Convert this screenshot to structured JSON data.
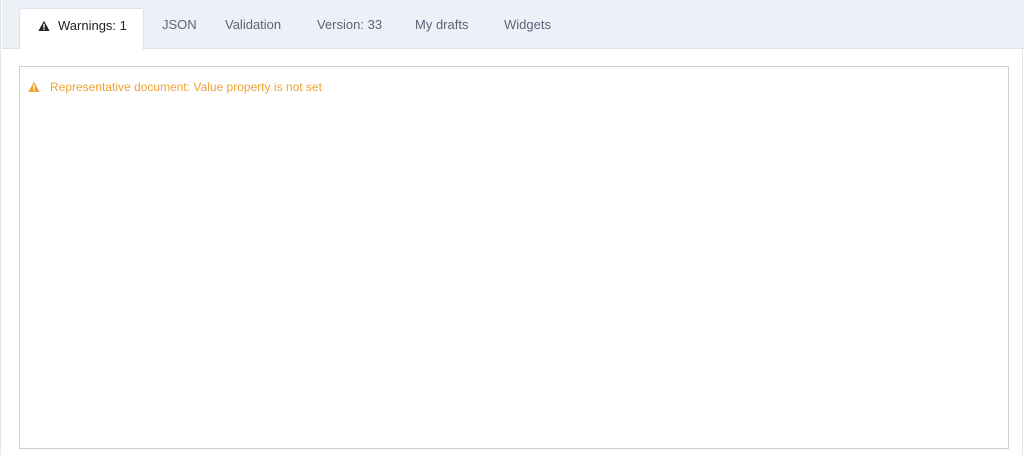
{
  "tabs": [
    {
      "label": "Warnings: 1",
      "icon": "warning-icon",
      "active": true
    },
    {
      "label": "JSON"
    },
    {
      "label": "Validation"
    },
    {
      "label": "Version: 33"
    },
    {
      "label": "My drafts"
    },
    {
      "label": "Widgets"
    }
  ],
  "panel": {
    "warnings": [
      {
        "icon": "warning-icon",
        "text": "Representative document: Value property is not set"
      }
    ]
  },
  "colors": {
    "tabbar_bg": "#eef0f8",
    "warning": "#f0a22e",
    "active_tab_text": "#222222",
    "tab_text": "#5b6478"
  }
}
